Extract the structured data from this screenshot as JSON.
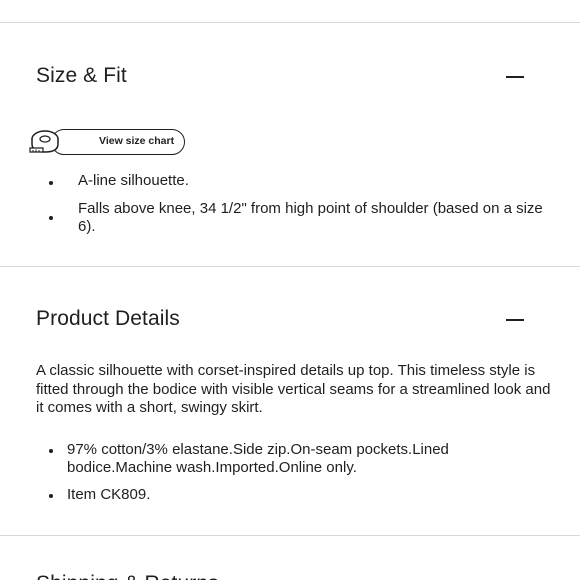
{
  "sections": [
    {
      "title": "Size & Fit",
      "collapse_label": "—",
      "size_chart_label": "View size chart",
      "bullets": [
        "A-line silhouette.",
        "Falls above knee, 34 1/2\" from high point of shoulder (based on a size 6)."
      ]
    },
    {
      "title": "Product Details",
      "collapse_label": "—",
      "description": "A classic silhouette with corset-inspired details up top. This timeless style is fitted through the bodice with visible vertical seams for a streamlined look and it comes with a short, swingy skirt.",
      "bullets": [
        "97% cotton/3% elastane.Side zip.On-seam pockets.Lined bodice.Machine wash.Imported.Online only.",
        "Item CK809."
      ]
    },
    {
      "title": "Shipping & Returns"
    }
  ],
  "icons": {
    "tape": "measuring-tape-icon",
    "collapse": "minus-icon"
  },
  "colors": {
    "text": "#1f1f1f",
    "divider": "#d9d9d9",
    "background": "#ffffff"
  }
}
